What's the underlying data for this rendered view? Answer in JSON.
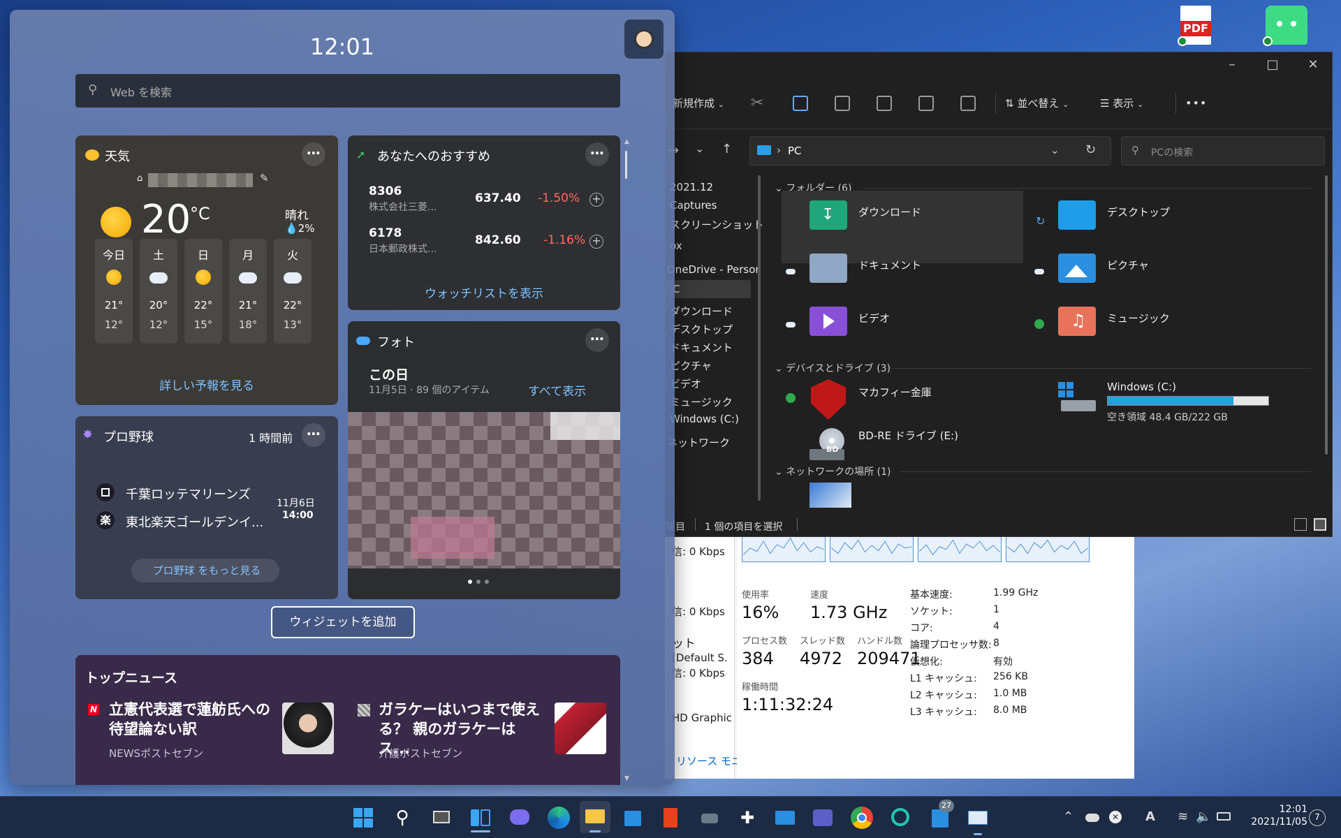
{
  "desktop": {
    "pdf_label": "PDF"
  },
  "explorer": {
    "toolbar": {
      "new_label": "新規作成",
      "sort_label": "並べ替え",
      "view_label": "表示",
      "more_label": "•••"
    },
    "address": {
      "path": "PC",
      "search_placeholder": "PCの検索"
    },
    "nav_items": [
      "2021.12",
      "Captures",
      "スクリーンショット",
      "ox",
      "OneDrive - Persor",
      "C",
      "ダウンロード",
      "デスクトップ",
      "ドキュメント",
      "ピクチャ",
      "ビデオ",
      "ミュージック",
      "Windows (C:)",
      "ネットワーク"
    ],
    "sections": {
      "folders": "フォルダー (6)",
      "devices": "デバイスとドライブ (3)",
      "network": "ネットワークの場所 (1)"
    },
    "folders": [
      {
        "label": "ダウンロード",
        "color": "#1fa67a"
      },
      {
        "label": "デスクトップ",
        "color": "#1e9ee8"
      },
      {
        "label": "ドキュメント",
        "color": "#8fa7c4"
      },
      {
        "label": "ピクチャ",
        "color": "#2a8fe0"
      },
      {
        "label": "ビデオ",
        "color": "#8a4fd8"
      },
      {
        "label": "ミュージック",
        "color": "#e8735a"
      }
    ],
    "drives": {
      "mcafee_label": "マカフィー金庫",
      "c_label": "Windows (C:)",
      "c_free": "空き領域 48.4 GB/222 GB",
      "c_used_fraction": 0.782,
      "bd_label": "BD-RE ドライブ (E:)",
      "bd_badge": "BD"
    },
    "status": {
      "items": "項目",
      "selected": "1 個の項目を選択"
    }
  },
  "taskmgr": {
    "left_labels": [
      "信: 0 Kbps",
      "信: 0 Kbps",
      "ット",
      "(Default S.",
      "信: 0 Kbps",
      "HD Graphic"
    ],
    "usage_label": "使用率",
    "usage_value": "16%",
    "speed_label": "速度",
    "speed_value": "1.73 GHz",
    "process_label": "プロセス数",
    "process_value": "384",
    "thread_label": "スレッド数",
    "thread_value": "4972",
    "handle_label": "ハンドル数",
    "handle_value": "209471",
    "uptime_label": "稼働時間",
    "uptime_value": "1:11:32:24",
    "specs": [
      {
        "k": "基本速度:",
        "v": "1.99 GHz"
      },
      {
        "k": "ソケット:",
        "v": "1"
      },
      {
        "k": "コア:",
        "v": "4"
      },
      {
        "k": "論理プロセッサ数:",
        "v": "8"
      },
      {
        "k": "仮想化:",
        "v": "有効"
      },
      {
        "k": "L1 キャッシュ:",
        "v": "256 KB"
      },
      {
        "k": "L2 キャッシュ:",
        "v": "1.0 MB"
      },
      {
        "k": "L3 キャッシュ:",
        "v": "8.0 MB"
      }
    ],
    "resource_monitor_link": "リソース モニターを開く"
  },
  "widgets": {
    "time": "12:01",
    "search_placeholder": "Web を検索",
    "weather": {
      "title": "天気",
      "temp": "20",
      "unit": "°C",
      "condition": "晴れ",
      "precip": "2%",
      "days": [
        {
          "d": "今日",
          "hi": "21°",
          "lo": "12°"
        },
        {
          "d": "土",
          "hi": "20°",
          "lo": "12°"
        },
        {
          "d": "日",
          "hi": "22°",
          "lo": "15°"
        },
        {
          "d": "月",
          "hi": "21°",
          "lo": "18°"
        },
        {
          "d": "火",
          "hi": "22°",
          "lo": "13°"
        }
      ],
      "forecast_link": "詳しい予報を見る"
    },
    "stocks": {
      "title": "あなたへのおすすめ",
      "items": [
        {
          "code": "8306",
          "name": "株式会社三菱...",
          "price": "637.40",
          "change": "-1.50%"
        },
        {
          "code": "6178",
          "name": "日本郵政株式...",
          "price": "842.60",
          "change": "-1.16%"
        }
      ],
      "watchlist_link": "ウォッチリストを表示"
    },
    "baseball": {
      "title": "プロ野球",
      "time_ago": "1 時間前",
      "team1": "千葉ロッテマリーンズ",
      "team2": "東北楽天ゴールデンイ...",
      "team2_badge": "楽",
      "date": "11月6日",
      "time": "14:00",
      "more_link": "プロ野球 をもっと見る"
    },
    "photos": {
      "title": "フォト",
      "subtitle": "この日",
      "meta": "11月5日 · 89 個のアイテム",
      "show_all": "すべて表示"
    },
    "add_widget": "ウィジェットを追加",
    "news": {
      "title": "トップニュース",
      "items": [
        {
          "title": "立憲代表選で蓮舫氏への待望論ない訳",
          "source": "NEWSポストセブン",
          "badge": "N"
        },
        {
          "title": "ガラケーはいつまで使える？ 親のガラケーはス...",
          "source": "介護ポストセブン",
          "badge": ""
        }
      ]
    }
  },
  "taskbar": {
    "clock_time": "12:01",
    "clock_date": "2021/11/05",
    "notification_count": "7",
    "app_badge": "27"
  }
}
